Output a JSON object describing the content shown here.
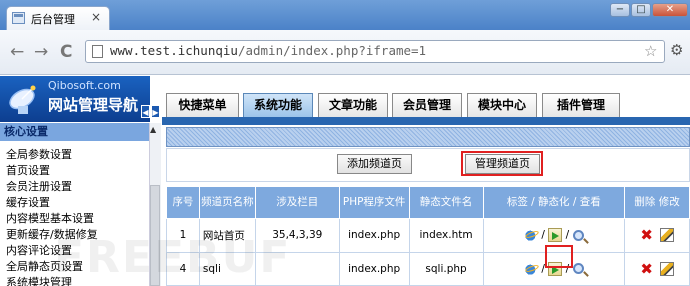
{
  "browser": {
    "tab_title": "后台管理",
    "tab_close": "×",
    "window_buttons": [
      "−",
      "□",
      "✕"
    ],
    "back": "←",
    "forward": "→",
    "reload": "C",
    "url_host": "www.test.ichunqiu",
    "url_path": "/admin/index.php?iframe=1",
    "star": "☆",
    "wrench": "🔧"
  },
  "logo": {
    "site": "Qibosoft.com",
    "title": "网站管理导航",
    "arrow_left": "◀",
    "arrow_right": "▶"
  },
  "sidebar": {
    "header": "核心设置",
    "items": [
      "全局参数设置",
      "首页设置",
      "会员注册设置",
      "缓存设置",
      "内容模型基本设置",
      "更新缓存/数据修复",
      "内容评论设置",
      "全局静态页设置",
      "系统模块管理"
    ]
  },
  "nav_tabs": [
    "快捷菜单",
    "系统功能",
    "文章功能",
    "会员管理",
    "模块中心",
    "插件管理"
  ],
  "active_tab": "系统功能",
  "buttons": {
    "add": "添加频道页",
    "manage": "管理频道页"
  },
  "table": {
    "headers": [
      "序号",
      "频道页名称",
      "涉及栏目",
      "PHP程序文件",
      "静态文件名",
      "标签 / 静态化 / 查看",
      "删除 修改"
    ],
    "rows": [
      {
        "id": "1",
        "name": "网站首页",
        "columns": "35,4,3,39",
        "php": "index.php",
        "static": "index.htm"
      },
      {
        "id": "4",
        "name": "sqli",
        "columns": "",
        "php": "index.php",
        "static": "sqli.php"
      }
    ],
    "slash": "/"
  },
  "watermark": "FREEBUF",
  "colors": {
    "nav_blue": "#2966b0",
    "header_blue": "#7ea9de",
    "highlight_red": "#e02020"
  }
}
